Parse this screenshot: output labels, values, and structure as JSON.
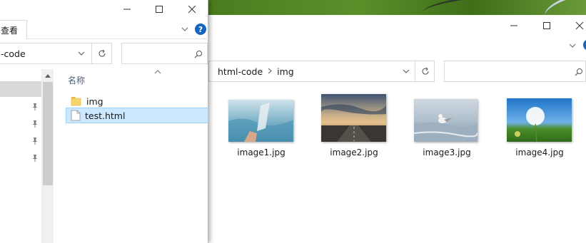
{
  "left_window": {
    "ribbon_tab": "查看",
    "address_text": "-code",
    "column_header": "名称",
    "files": [
      {
        "name": "img",
        "icon": "folder-icon",
        "selected": false
      },
      {
        "name": "test.html",
        "icon": "html-file-icon",
        "selected": true
      }
    ]
  },
  "right_window": {
    "breadcrumb": [
      "html-code",
      "img"
    ],
    "files": [
      {
        "name": "image1.jpg",
        "icon": "image-thumbnail"
      },
      {
        "name": "image2.jpg",
        "icon": "image-thumbnail"
      },
      {
        "name": "image3.jpg",
        "icon": "image-thumbnail"
      },
      {
        "name": "image4.jpg",
        "icon": "image-thumbnail"
      }
    ]
  },
  "glyphs": {
    "minimize": "—",
    "maximize": "☐",
    "close": "✕",
    "chevron_down": "⌄",
    "chevron_up": "︿",
    "refresh": "↻",
    "search": "⚲",
    "help": "?",
    "pin": "📌"
  },
  "colors": {
    "selection_bg": "#cce8ff",
    "selection_border": "#99d1ff",
    "help_blue": "#1565c0",
    "desktop_green": "#4a7c1e"
  }
}
